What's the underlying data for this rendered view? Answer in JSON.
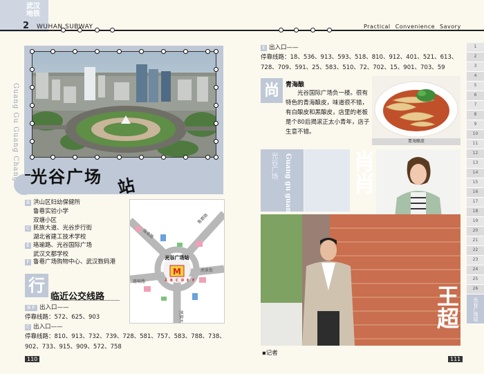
{
  "header": {
    "logo_text": "武汉地铁",
    "page_number_top": "2",
    "magazine_name": "WUHAN SUBWAY",
    "tagline": "Practical Convenience Savory"
  },
  "left_page": {
    "vertical_en": "Guang Gu Guang Chang",
    "station_title": "光谷广场",
    "station_suffix": "站",
    "exits": [
      {
        "badge": "B",
        "text": "洪山区妇幼保健所"
      },
      {
        "badge": "",
        "text": "鲁巷实验小学"
      },
      {
        "badge": "",
        "text": "双塘小区"
      },
      {
        "badge": "C",
        "text": "民族大道、光谷步行街"
      },
      {
        "badge": "",
        "text": "湖北省建工技术学校"
      },
      {
        "badge": "E",
        "text": "珞瑜路、光谷国际广场"
      },
      {
        "badge": "",
        "text": "武汉文都学校"
      },
      {
        "badge": "F",
        "text": "鲁巷广场购物中心、武汉数码港"
      }
    ],
    "map": {
      "station_label": "光谷广场站",
      "metro_symbol": "M",
      "road_labels": [
        "珞瑜路",
        "鲁磨路",
        "民族大道",
        "珞喻路",
        "虎泉街"
      ],
      "exit_letters": [
        "A",
        "B",
        "C",
        "D",
        "E",
        "F"
      ]
    },
    "bus_char": "行",
    "bus_title": "临近公交线路",
    "bus_groups": [
      {
        "badge": "B F",
        "exit_label": "出入口——",
        "lines_label": "停靠线路：",
        "lines": "572、625、903"
      },
      {
        "badge": "C",
        "exit_label": "出入口——",
        "lines_label": "停靠线路：",
        "lines": "810、913、732、739、728、581、757、583、788、738、902、733、915、909、572、758"
      }
    ],
    "page_number": "110"
  },
  "right_page": {
    "exit_badge": "E",
    "exit_label": "出入口——",
    "lines_label": "停靠线路：",
    "lines": "18、536、913、593、518、810、912、401、521、613、728、709、591、25、583、510、72、702、15、901、703、59",
    "shang_char": "尚",
    "shop_title": "青海酿",
    "shop_text": "光谷国际广场负一楼。很有特色的青海酿皮，味道很不错，有白酿皮和黑酿皮，店里的老板是个80后揭滚正太小青年，店子生意不错。",
    "food_caption": "青海酿皮",
    "gg_en": "Guang gu guang chang",
    "gg_cn": "光谷广场",
    "person1_name": "肖肖",
    "person2_name": "王超",
    "reporter_label": "记者",
    "page_number": "111",
    "side_tabs": [
      "1",
      "2",
      "3",
      "4",
      "5",
      "6",
      "7",
      "8",
      "9",
      "10",
      "11",
      "12",
      "13",
      "14",
      "15",
      "16",
      "17",
      "18",
      "19",
      "20",
      "21",
      "22",
      "23",
      "24",
      "25",
      "26",
      "光谷广场站"
    ]
  },
  "colors": {
    "accent_blue": "#bfc8d6",
    "paper": "#fbf8ee",
    "text": "#222222"
  }
}
